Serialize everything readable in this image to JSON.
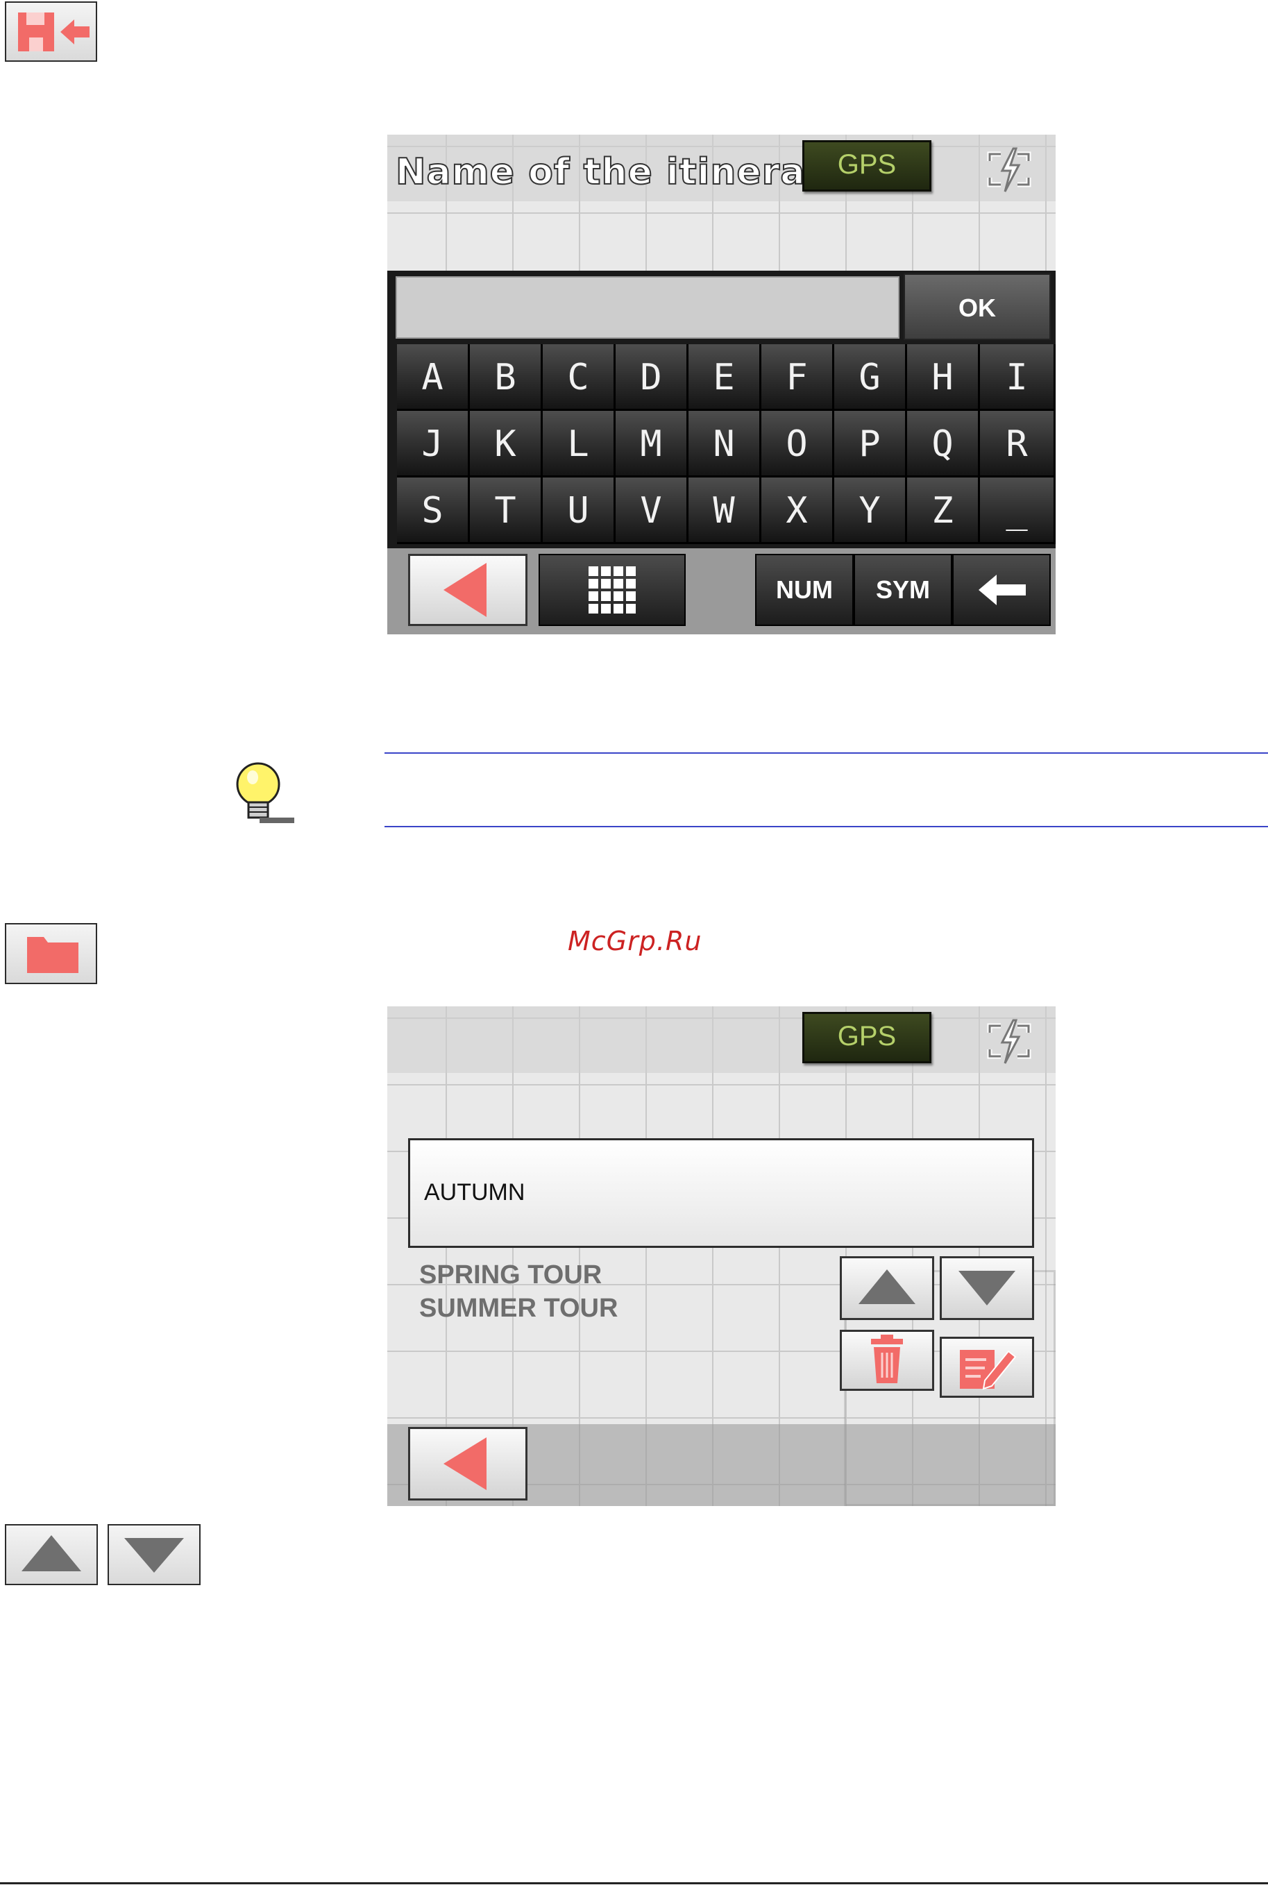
{
  "keyboard_screen": {
    "title": "Name of the itinera",
    "gps_label": "GPS",
    "ok_label": "OK",
    "keys": [
      [
        "A",
        "B",
        "C",
        "D",
        "E",
        "F",
        "G",
        "H",
        "I"
      ],
      [
        "J",
        "K",
        "L",
        "M",
        "N",
        "O",
        "P",
        "Q",
        "R"
      ],
      [
        "S",
        "T",
        "U",
        "V",
        "W",
        "X",
        "Y",
        "Z",
        "_"
      ]
    ],
    "num_label": "NUM",
    "sym_label": "SYM"
  },
  "watermark": "McGrp.Ru",
  "list_screen": {
    "gps_label": "GPS",
    "selected_item": "AUTUMN",
    "items": [
      "SPRING TOUR",
      "SUMMER TOUR"
    ]
  },
  "colors": {
    "accent_red": "#f26b68",
    "gps_text": "#b5d06a",
    "tip_rule": "#3a44c8",
    "watermark": "#cc2222"
  },
  "icons": {
    "save": "save-itinerary-icon",
    "folder": "folder-icon",
    "up": "scroll-up-icon",
    "down": "scroll-down-icon",
    "tip": "lightbulb-icon"
  }
}
